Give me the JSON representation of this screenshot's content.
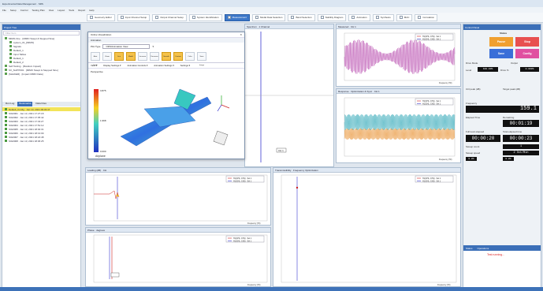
{
  "window": {
    "title": "Experimental Data Management · SRS"
  },
  "menu": [
    "File",
    "Setup",
    "Control",
    "Testing Plan",
    "View",
    "Layout",
    "Tools",
    "Report",
    "Help"
  ],
  "tabs": [
    {
      "label": "Geometry Editor",
      "active": false
    },
    {
      "label": "Input Channel Setup",
      "active": false
    },
    {
      "label": "Output Channel Setup",
      "active": false
    },
    {
      "label": "System Identification",
      "active": false
    },
    {
      "label": "Measurement",
      "active": true
    },
    {
      "label": "Modal Data Selection",
      "active": false
    },
    {
      "label": "Band Selection",
      "active": false
    },
    {
      "label": "Stability Diagram",
      "active": false
    },
    {
      "label": "Animation",
      "active": false
    },
    {
      "label": "Synthesis",
      "active": false
    },
    {
      "label": "MAC",
      "active": false
    },
    {
      "label": "Correlation",
      "active": false
    }
  ],
  "sidebar": {
    "header": "Project Tree",
    "search_placeholder": "Filter Item",
    "items": [
      {
        "label": "MIMO-One · [MIMO Swept & Stepped Sine]",
        "hl": false
      },
      {
        "label": "system_01_[MIMO]",
        "hl": false
      },
      {
        "label": "Signals",
        "hl": false
      },
      {
        "label": "Default_1",
        "hl": false
      },
      {
        "label": "Input Tables",
        "hl": false
      },
      {
        "label": "Default_1",
        "hl": false
      },
      {
        "label": "Default_2",
        "hl": false
      },
      {
        "label": "Self Testing · [Random Impact]",
        "hl": false
      },
      {
        "label": "SV_SHPI7001 · [MIMO Swept & Stepped Sine]",
        "hl": false
      },
      {
        "label": "[SHAKER] · [Impact MIMO Data]",
        "hl": false
      }
    ],
    "bottom_tabs": [
      "Run Log",
      "Bookmarks",
      "Data Files"
    ],
    "records": [
      {
        "label": "Default_Config · Jan 13, 2021 09:33:47",
        "hl": true
      },
      {
        "label": "SIG0001 · Jan 13, 2021 17:27:18",
        "hl": false
      },
      {
        "label": "SIG0002 · Jan 13, 2021 17:35:42",
        "hl": false
      },
      {
        "label": "SIG0003 · Jan 13, 2021 17:43:27",
        "hl": false
      },
      {
        "label": "SIG0004 · Jan 13, 2021 17:51:12",
        "hl": false
      },
      {
        "label": "SIG0005 · Jan 13, 2021 18:02:31",
        "hl": false
      },
      {
        "label": "SIG0006 · Jan 13, 2021 18:13:09",
        "hl": false
      },
      {
        "label": "SIG0007 · Jan 13, 2021 18:24:48",
        "hl": false
      },
      {
        "label": "SIG0008 · Jan 13, 2021 18:36:25",
        "hl": false
      }
    ]
  },
  "dialog": {
    "title": "Online Visualization",
    "subtitle": "Animation",
    "plot_type_label": "Plot Type",
    "plot_type_value": "ODS/Animation View",
    "ribbon": [
      "Auto Scale",
      "Zoom",
      "Line",
      "Model",
      "Increase",
      "Decrease",
      "Smooth",
      "Contour",
      "Color",
      "Save Image"
    ],
    "sub_ribbon": [
      "View",
      "Display Settings",
      "Animation Controls",
      "Animation Settings",
      "Settings"
    ],
    "view_label": "Perspective",
    "colorbar_max": "3.875",
    "colorbar_mid": "1.968",
    "colorbar_min": "0.000",
    "model_name": "Airplane"
  },
  "plots": {
    "top_mid_title": "Spectrum · 1 Channel",
    "top_mid_ch": "CH 1",
    "right1_title": "Measured · CH 1",
    "right2_title": "Response · Optimization & Sync · CH 1",
    "bottom_left_title": "Loading (dB) · CH",
    "bottom_left2_title": "Phase · degrees",
    "bottom_right_title": "Transmissibility · Frequency Optimization",
    "legend": [
      "H1(CH1, CH1) · Sel 1",
      "H1(CH1, CH2) · Sel 1"
    ],
    "freq_label": "Frequency (Hz)"
  },
  "control": {
    "header": "Control Panel",
    "status": "Status",
    "buttons": {
      "pause": "Pause",
      "stop": "Stop",
      "save": "Save",
      "config": "Config"
    },
    "drive_mode": "Drive Mode",
    "output": "Output",
    "level_label": "Level",
    "level_value": "100.00%",
    "drive_pct_label": "Drive %",
    "drive_pct_value": "0.000%",
    "ctrl_peak_label": "Ctrl peak (dB)",
    "target_peak_label": "Target peak (dB)",
    "frequency_label": "Frequency",
    "frequency_value": "159.1",
    "elapsed_label": "Elapsed Time",
    "remaining_label": "Remaining",
    "remaining_value": "00:01:19",
    "full_level_label": "Full level elapsed",
    "total_label": "Total elapsed time",
    "full_level_value": "00:00:20",
    "total_value": "00:00:23",
    "sweep_count_label": "Sweep count",
    "sweep_count_value": "1",
    "sweep_speed_label": "Sweep speed",
    "sweep_speed_value": "2 Oct/Min",
    "mini_values": [
      "0.0%",
      "0.0%"
    ],
    "log_tabs": [
      "Status",
      "Operations"
    ],
    "log_message": "Test running..."
  },
  "colors": {
    "accent": "#3d78c9",
    "pause": "#f0a030",
    "stop": "#e85050",
    "save": "#3a6fd8",
    "config": "#e050a0",
    "timer_text": "#ffffff"
  }
}
